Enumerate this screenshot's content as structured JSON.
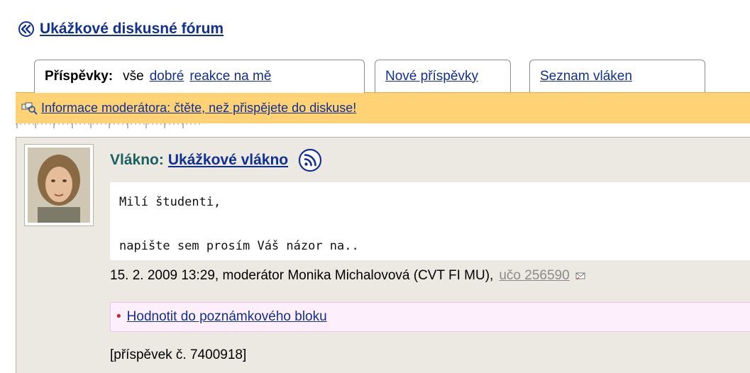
{
  "header": {
    "forum_title": "Ukážkové diskusné fórum"
  },
  "tabs": {
    "posts_label": "Příspěvky:",
    "filter_all": "vše",
    "filter_good": "dobré",
    "filter_replies": "reakce na mě",
    "new_posts": "Nové příspěvky",
    "threads_list": "Seznam vláken"
  },
  "moderator_info": {
    "text": "Informace moderátora: čtěte, než přispějete do diskuse!"
  },
  "post": {
    "thread_label": "Vlákno:",
    "thread_title": "Ukážkové vlákno",
    "message_line1": "Milí študenti,",
    "message_line2": "napište sem prosím Váš názor na..",
    "meta_text": "15. 2. 2009 13:29, moderátor Monika Michalovová (CVT FI MU),",
    "uco": "učo 256590",
    "rate_link": "Hodnotit do poznámkového bloku",
    "bullet": "•",
    "post_number": "[příspěvek č. 7400918]"
  },
  "icons": {
    "back": "double-chevron-left-icon",
    "info": "magnifier-icon",
    "rss": "rss-icon",
    "contact": "mail-icon"
  },
  "colors": {
    "link": "#12308f",
    "info_bar": "#ffd275",
    "post_bg": "#ece9e2",
    "rate_bg": "#fdf0fc"
  }
}
